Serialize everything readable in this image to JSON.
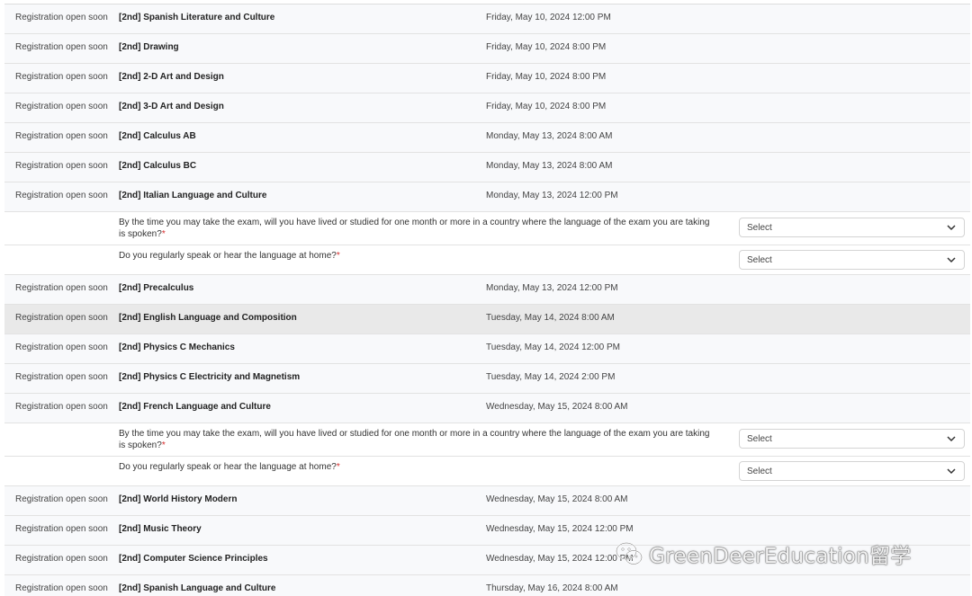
{
  "status_label": "Registration open soon",
  "select_placeholder": "Select",
  "questions": {
    "lived_abroad": "By the time you may take the exam, will you have lived or studied for one month or more in a country where the language of the exam you are taking is spoken?",
    "speak_at_home": "Do you regularly speak or hear the language at home?",
    "required_mark": "*"
  },
  "exams": [
    {
      "name": "[2nd] Spanish Literature and Culture",
      "date": "Friday, May 10, 2024 12:00 PM"
    },
    {
      "name": "[2nd] Drawing",
      "date": "Friday, May 10, 2024 8:00 PM"
    },
    {
      "name": "[2nd] 2-D Art and Design",
      "date": "Friday, May 10, 2024 8:00 PM"
    },
    {
      "name": "[2nd] 3-D Art and Design",
      "date": "Friday, May 10, 2024 8:00 PM"
    },
    {
      "name": "[2nd] Calculus AB",
      "date": "Monday, May 13, 2024 8:00 AM"
    },
    {
      "name": "[2nd] Calculus BC",
      "date": "Monday, May 13, 2024 8:00 AM"
    },
    {
      "name": "[2nd] Italian Language and Culture",
      "date": "Monday, May 13, 2024 12:00 PM"
    },
    {
      "name": "[2nd] Precalculus",
      "date": "Monday, May 13, 2024 12:00 PM"
    },
    {
      "name": "[2nd] English Language and Composition",
      "date": "Tuesday, May 14, 2024 8:00 AM"
    },
    {
      "name": "[2nd] Physics C Mechanics",
      "date": "Tuesday, May 14, 2024 12:00 PM"
    },
    {
      "name": "[2nd] Physics C Electricity and Magnetism",
      "date": "Tuesday, May 14, 2024 2:00 PM"
    },
    {
      "name": "[2nd] French Language and Culture",
      "date": "Wednesday, May 15, 2024 8:00 AM"
    },
    {
      "name": "[2nd] World History Modern",
      "date": "Wednesday, May 15, 2024 8:00 AM"
    },
    {
      "name": "[2nd] Music Theory",
      "date": "Wednesday, May 15, 2024 12:00 PM"
    },
    {
      "name": "[2nd] Computer Science Principles",
      "date": "Wednesday, May 15, 2024 12:00 PM"
    },
    {
      "name": "[2nd] Spanish Language and Culture",
      "date": "Thursday, May 16, 2024 8:00 AM"
    }
  ],
  "watermark": "GreenDeerEducation留学"
}
